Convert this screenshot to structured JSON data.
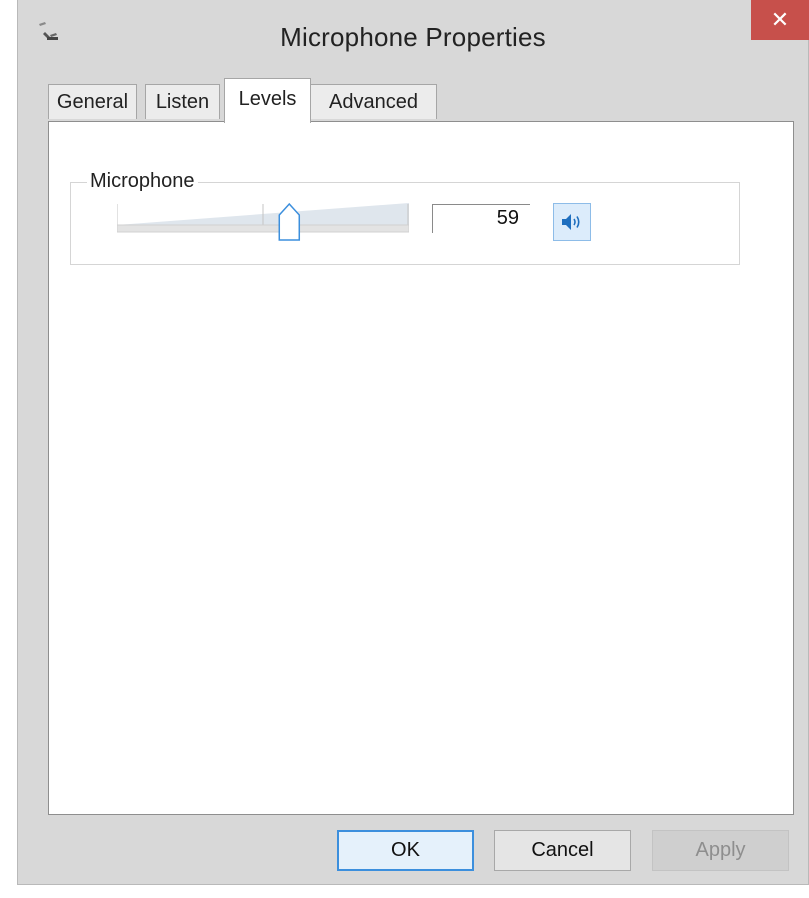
{
  "window": {
    "title": "Microphone Properties",
    "title_icon": "microphone-icon",
    "close_icon": "close-icon",
    "close_glyph": "✕",
    "close_color": "#c7504b"
  },
  "tabs": [
    {
      "label": "General",
      "active": false
    },
    {
      "label": "Listen",
      "active": false
    },
    {
      "label": "Levels",
      "active": true
    },
    {
      "label": "Advanced",
      "active": false
    }
  ],
  "levels": {
    "group_label": "Microphone",
    "slider": {
      "value": 59,
      "min": 0,
      "max": 100
    },
    "value_text": "59",
    "mute_icon": "speaker-icon",
    "accent_color": "#3c8fdd"
  },
  "buttons": {
    "ok": "OK",
    "cancel": "Cancel",
    "apply": "Apply",
    "apply_enabled": false
  }
}
